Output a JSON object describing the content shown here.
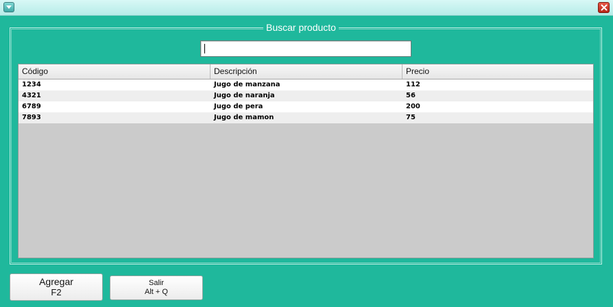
{
  "window": {
    "menu_icon": "chevron-down-icon",
    "close_icon": "close-icon"
  },
  "panel": {
    "title": "Buscar producto"
  },
  "search": {
    "value": ""
  },
  "table": {
    "columns": [
      "Código",
      "Descripción",
      "Precio"
    ],
    "rows": [
      [
        "1234",
        "Jugo de manzana",
        "112"
      ],
      [
        "4321",
        "Jugo de naranja",
        "56"
      ],
      [
        "6789",
        "Jugo de pera",
        "200"
      ],
      [
        "7893",
        "Jugo de mamon",
        "75"
      ]
    ]
  },
  "buttons": {
    "add": {
      "line1": "Agregar",
      "line2": "F2"
    },
    "exit": {
      "line1": "Salir",
      "line2": "Alt + Q"
    }
  },
  "colors": {
    "background": "#1fb89c",
    "close": "#c8301f"
  }
}
